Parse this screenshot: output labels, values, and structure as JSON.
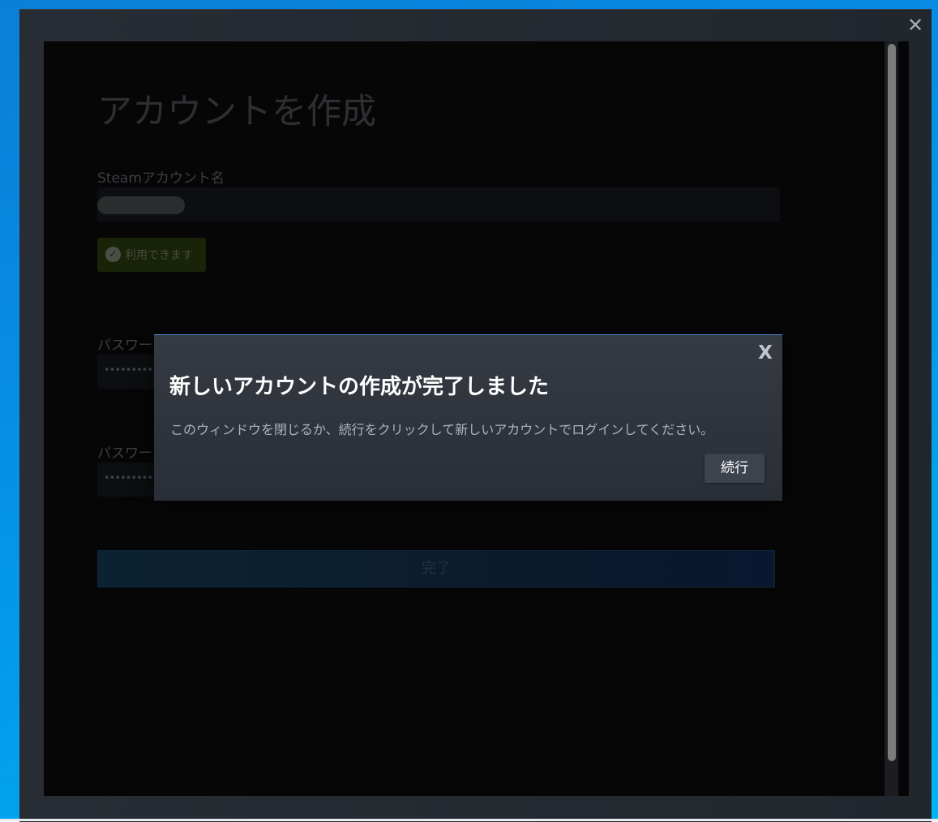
{
  "window": {
    "close_glyph": "✕"
  },
  "form": {
    "title": "アカウントを作成",
    "account_name_label": "Steamアカウント名",
    "availability_text": "利用できます",
    "password_label": "パスワー",
    "password_confirm_label": "パスワー",
    "password_dots": "••••••••••",
    "password_confirm_dots": "••••••••••",
    "done_button": "完了"
  },
  "modal": {
    "title": "新しいアカウントの作成が完了しました",
    "message": "このウィンドウを閉じるか、続行をクリックして新しいアカウントでログインしてください。",
    "continue_button": "続行",
    "close_glyph": "X"
  },
  "colors": {
    "modal_accent": "#4b8bd9",
    "availability_green": "#192308"
  }
}
